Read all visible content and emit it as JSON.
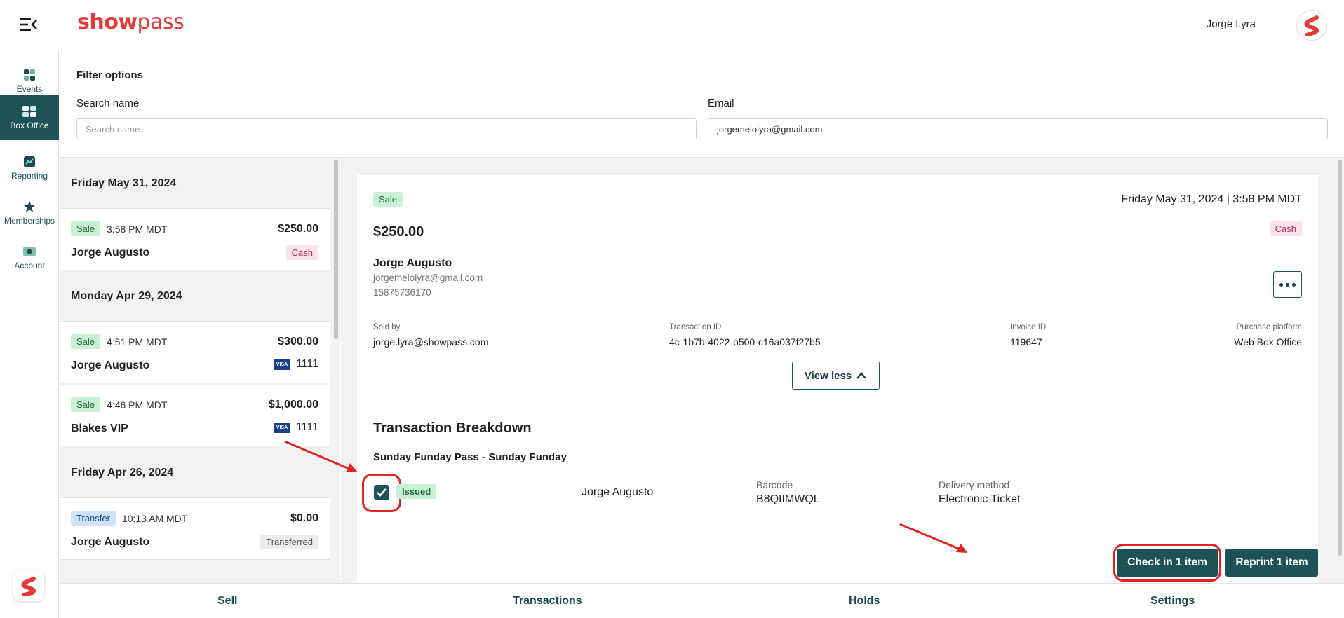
{
  "app": {
    "logo_bold": "show",
    "logo_light": "pass"
  },
  "user": {
    "name": "Jorge Lyra"
  },
  "sidenav": {
    "items": [
      {
        "label": "Events",
        "icon": "grid-icon"
      },
      {
        "label": "Box Office",
        "icon": "ticket-icon",
        "active": true
      },
      {
        "label": "Reporting",
        "icon": "chart-icon"
      },
      {
        "label": "Memberships",
        "icon": "star-icon"
      },
      {
        "label": "Account",
        "icon": "account-icon"
      }
    ]
  },
  "filters": {
    "title": "Filter options",
    "search_label": "Search name",
    "search_placeholder": "Search name",
    "search_value": "",
    "email_label": "Email",
    "email_value": "jorgemelolyra@gmail.com"
  },
  "list": {
    "day1": "Friday May 31, 2024",
    "day2": "Monday Apr 29, 2024",
    "day3": "Friday Apr 26, 2024",
    "txns": [
      {
        "type": "Sale",
        "time": "3:58 PM MDT",
        "amount": "$250.00",
        "name": "Jorge Augusto",
        "pay": "Cash"
      },
      {
        "type": "Sale",
        "time": "4:51 PM MDT",
        "amount": "$300.00",
        "name": "Jorge Augusto",
        "card_brand": "VISA",
        "pay": "1111"
      },
      {
        "type": "Sale",
        "time": "4:46 PM MDT",
        "amount": "$1,000.00",
        "name": "Blakes VIP",
        "card_brand": "VISA",
        "pay": "1111"
      },
      {
        "type": "Transfer",
        "time": "10:13 AM MDT",
        "amount": "$0.00",
        "name": "Jorge Augusto",
        "pay": "Transferred"
      }
    ]
  },
  "detail": {
    "type": "Sale",
    "datetime": "Friday May 31, 2024 | 3:58 PM MDT",
    "amount": "$250.00",
    "payment": "Cash",
    "customer_name": "Jorge Augusto",
    "customer_email": "jorgemelolyra@gmail.com",
    "customer_phone": "15875736170",
    "sold_by_label": "Sold by",
    "sold_by": "jorge.lyra@showpass.com",
    "txn_id_label": "Transaction ID",
    "txn_id": "4c-1b7b-4022-b500-c16a037f27b5",
    "invoice_label": "Invoice ID",
    "invoice": "119647",
    "platform_label": "Purchase platform",
    "platform": "Web Box Office",
    "view_less": "View less",
    "breakdown_title": "Transaction Breakdown",
    "item_title": "Sunday Funday Pass - Sunday Funday",
    "item": {
      "checked": true,
      "status": "Issued",
      "holder": "Jorge Augusto",
      "barcode_label": "Barcode",
      "barcode": "B8QIIMWQL",
      "delivery_label": "Delivery method",
      "delivery": "Electronic Ticket"
    },
    "checkin_btn": "Check in 1 item",
    "reprint_btn": "Reprint 1 item"
  },
  "bottom_tabs": [
    {
      "label": "Sell"
    },
    {
      "label": "Transactions",
      "active": true
    },
    {
      "label": "Holds"
    },
    {
      "label": "Settings"
    }
  ],
  "colors": {
    "brand": "#e53935",
    "primary": "#1d5257",
    "annotation": "#e02424"
  }
}
